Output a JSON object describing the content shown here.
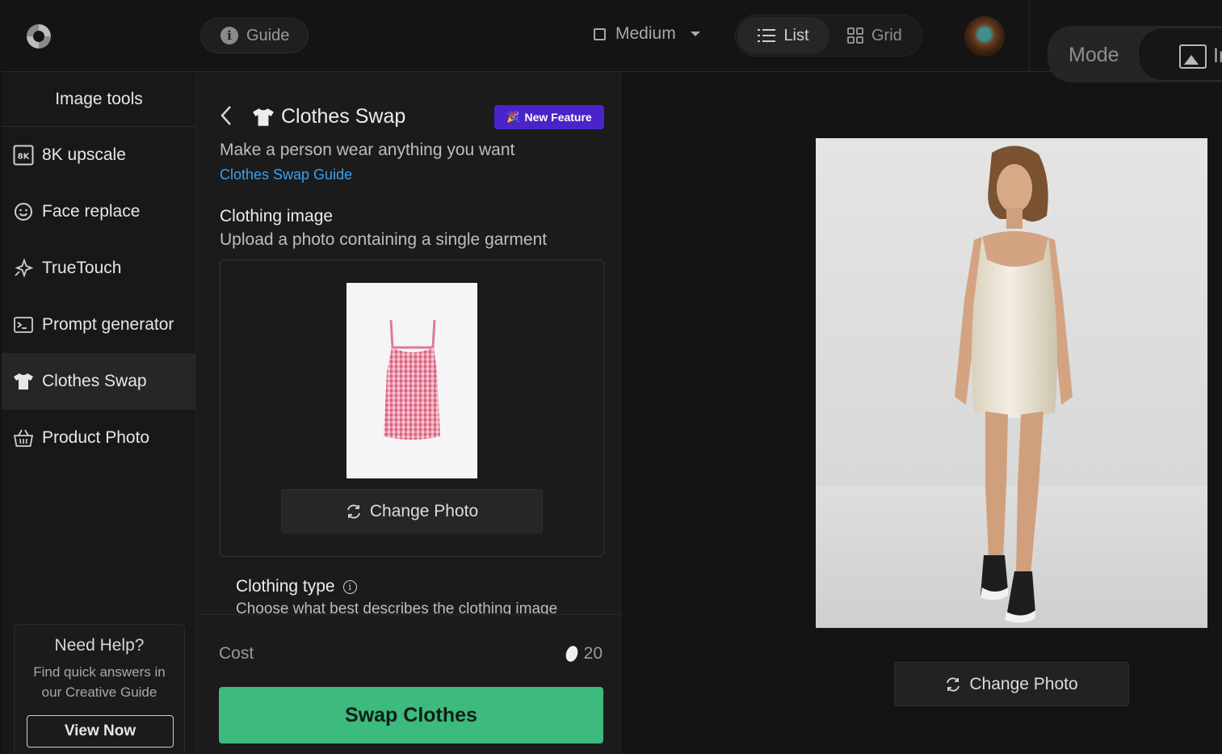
{
  "topbar": {
    "guide_label": "Guide",
    "size_label": "Medium",
    "view_list_label": "List",
    "view_grid_label": "Grid",
    "mode_label": "Mode",
    "mode_value_partial": "Ir"
  },
  "sidebar": {
    "title": "Image tools",
    "items": [
      {
        "label": "8K upscale",
        "icon": "8k-icon"
      },
      {
        "label": "Face replace",
        "icon": "smiley-icon"
      },
      {
        "label": "TrueTouch",
        "icon": "sparkle-icon"
      },
      {
        "label": "Prompt generator",
        "icon": "terminal-icon"
      },
      {
        "label": "Clothes Swap",
        "icon": "tshirt-icon",
        "active": true
      },
      {
        "label": "Product Photo",
        "icon": "basket-icon"
      }
    ],
    "help": {
      "title": "Need Help?",
      "text": "Find quick answers in our Creative Guide",
      "button": "View Now"
    }
  },
  "panel": {
    "title": "Clothes Swap",
    "badge": "New Feature",
    "subtitle": "Make a person wear anything you want",
    "guide_link": "Clothes Swap Guide",
    "clothing_image": {
      "title": "Clothing image",
      "subtitle": "Upload a photo containing a single garment",
      "change_button": "Change Photo"
    },
    "clothing_type": {
      "title": "Clothing type",
      "subtitle": "Choose what best describes the clothing image"
    },
    "cost_label": "Cost",
    "cost_value": "20",
    "submit": "Swap Clothes"
  },
  "preview": {
    "change_button": "Change Photo"
  },
  "colors": {
    "accent_green": "#3dba7e",
    "badge_purple": "#4a24c8",
    "link_blue": "#3aa0ef",
    "background": "#141414"
  }
}
